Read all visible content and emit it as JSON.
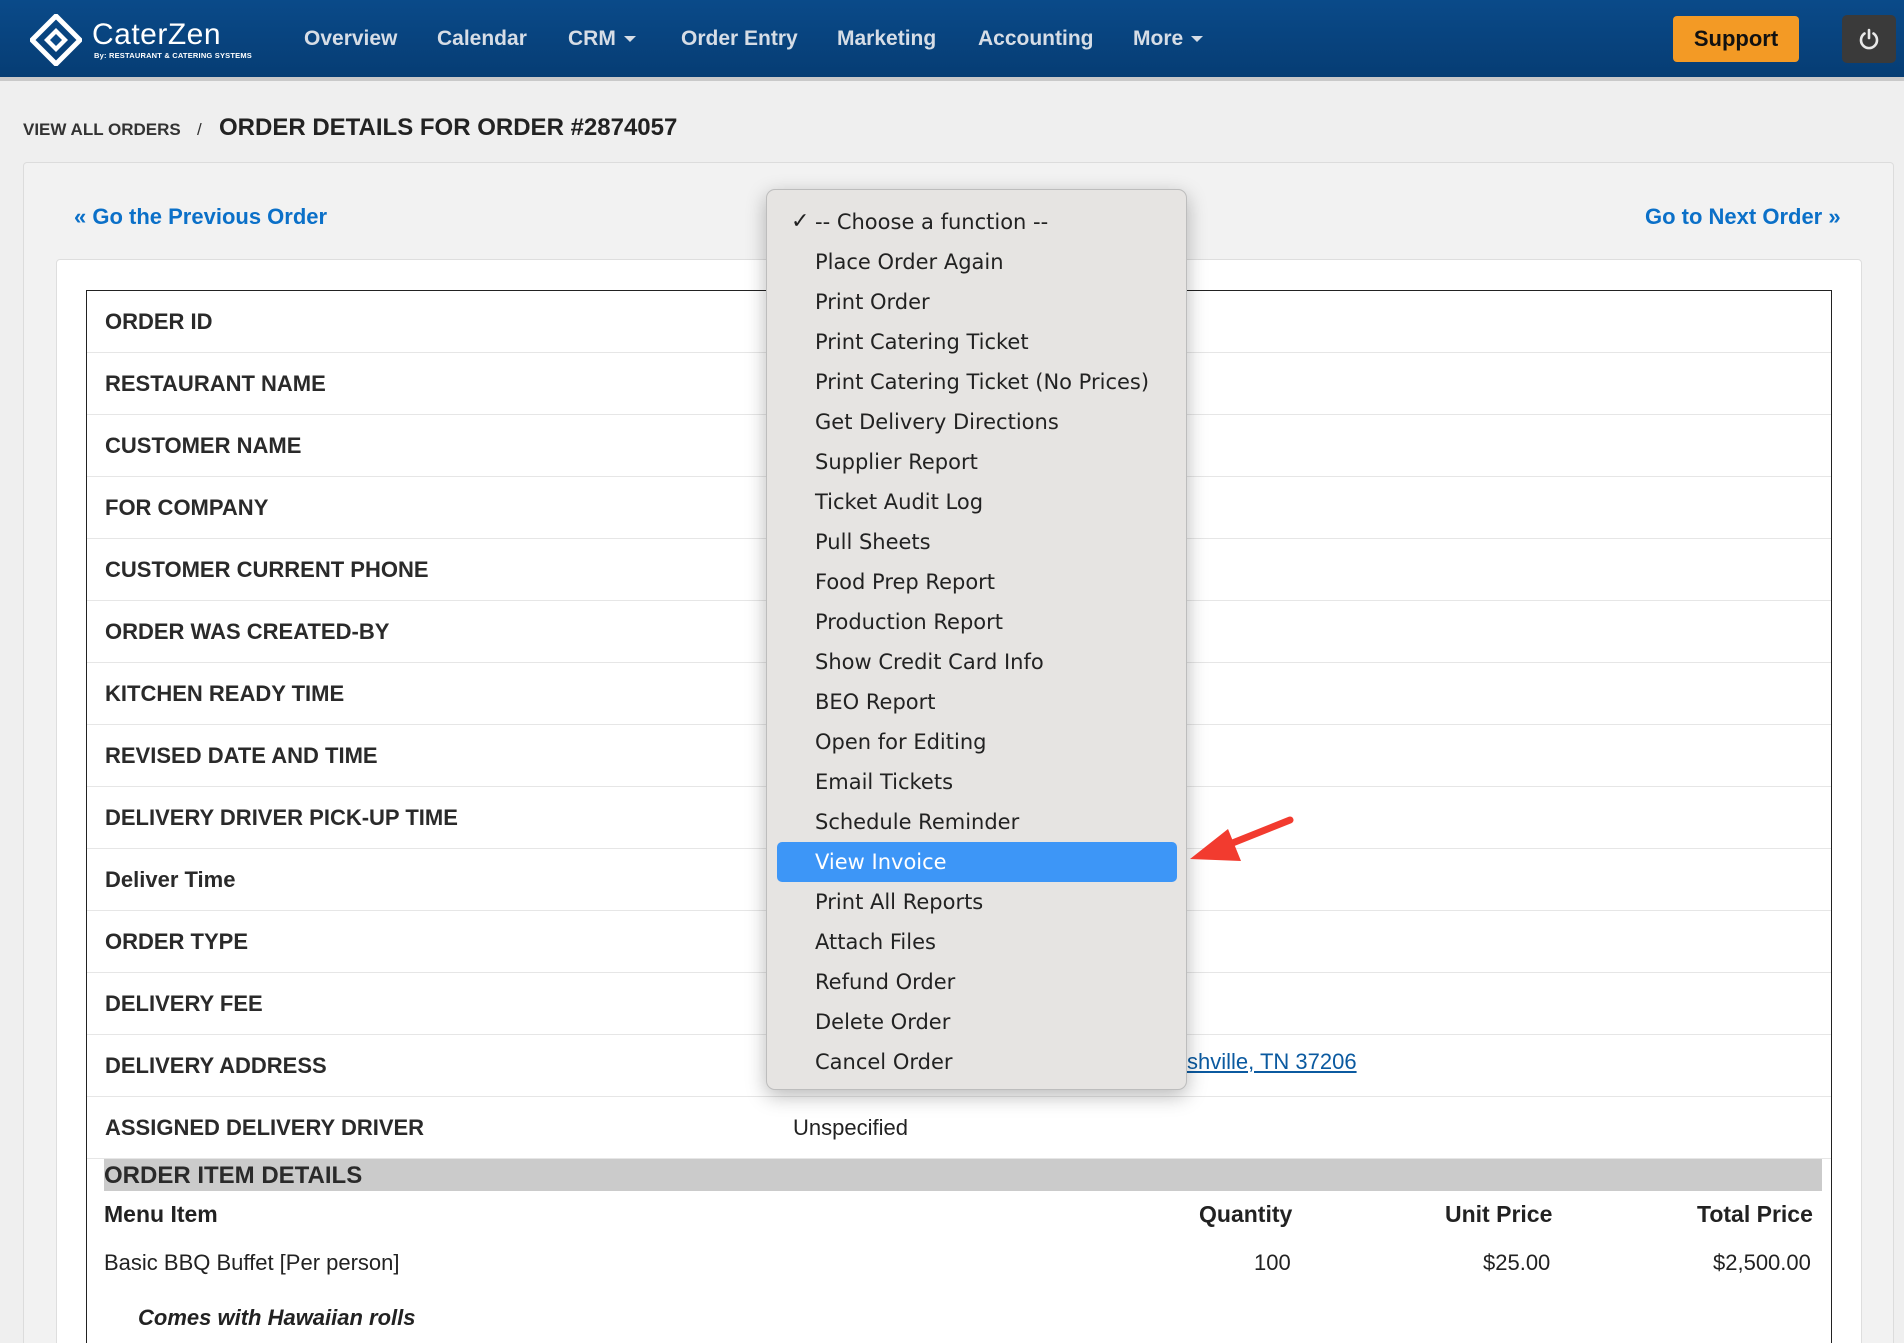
{
  "app": {
    "brand": "CaterZen",
    "tagline": "By: RESTAURANT & CATERING SYSTEMS"
  },
  "nav": {
    "items": [
      {
        "label": "Overview",
        "has_caret": false
      },
      {
        "label": "Calendar",
        "has_caret": false
      },
      {
        "label": "CRM",
        "has_caret": true
      },
      {
        "label": "Order Entry",
        "has_caret": false
      },
      {
        "label": "Marketing",
        "has_caret": false
      },
      {
        "label": "Accounting",
        "has_caret": false
      },
      {
        "label": "More",
        "has_caret": true
      }
    ],
    "support_label": "Support"
  },
  "breadcrumb": {
    "link": "VIEW ALL ORDERS",
    "separator": "/",
    "title": "ORDER DETAILS FOR ORDER #2874057"
  },
  "pager": {
    "prev": "« Go the Previous Order",
    "next": "Go to Next Order »"
  },
  "details": [
    {
      "label": "ORDER ID",
      "value": ""
    },
    {
      "label": "RESTAURANT NAME",
      "value": ""
    },
    {
      "label": "CUSTOMER NAME",
      "value": ""
    },
    {
      "label": "FOR COMPANY",
      "value": ""
    },
    {
      "label": "CUSTOMER CURRENT PHONE",
      "value": ""
    },
    {
      "label": "ORDER WAS CREATED-BY",
      "value": ""
    },
    {
      "label": "KITCHEN READY TIME",
      "value": ""
    },
    {
      "label": "REVISED DATE AND TIME",
      "value": ""
    },
    {
      "label": "DELIVERY DRIVER PICK-UP TIME",
      "value": ""
    },
    {
      "label": "Deliver Time",
      "value": ""
    },
    {
      "label": "ORDER TYPE",
      "value": ""
    },
    {
      "label": "DELIVERY FEE",
      "value": ""
    },
    {
      "label": "DELIVERY ADDRESS",
      "value": ""
    },
    {
      "label": "ASSIGNED DELIVERY DRIVER",
      "value": "Unspecified"
    }
  ],
  "delivery_address_visible": "shville, TN 37206",
  "order_items": {
    "section_title": "ORDER ITEM DETAILS",
    "columns": {
      "menu_item": "Menu Item",
      "quantity": "Quantity",
      "unit_price": "Unit Price",
      "total_price": "Total Price"
    },
    "rows": [
      {
        "menu_item": "Basic BBQ Buffet [Per person]",
        "quantity": "100",
        "unit_price": "$25.00",
        "total_price": "$2,500.00",
        "note": "Comes with Hawaiian rolls"
      }
    ]
  },
  "function_menu": {
    "checked_index": 0,
    "highlighted_index": 16,
    "check_glyph": "✓",
    "options": [
      "-- Choose a function --",
      "Place Order Again",
      "Print Order",
      "Print Catering Ticket",
      "Print Catering Ticket (No Prices)",
      "Get Delivery Directions",
      "Supplier Report",
      "Ticket Audit Log",
      "Pull Sheets",
      "Food Prep Report",
      "Production Report",
      "Show Credit Card Info",
      "BEO Report",
      "Open for Editing",
      "Email Tickets",
      "Schedule Reminder",
      "View Invoice",
      "Print All Reports",
      "Attach Files",
      "Refund Order",
      "Delete Order",
      "Cancel Order"
    ]
  },
  "colors": {
    "nav_bg": "#0a4a89",
    "support_bg": "#f39a25",
    "link": "#0b70c8",
    "highlight": "#3d96f7",
    "annotation_arrow": "#f23b2f"
  }
}
